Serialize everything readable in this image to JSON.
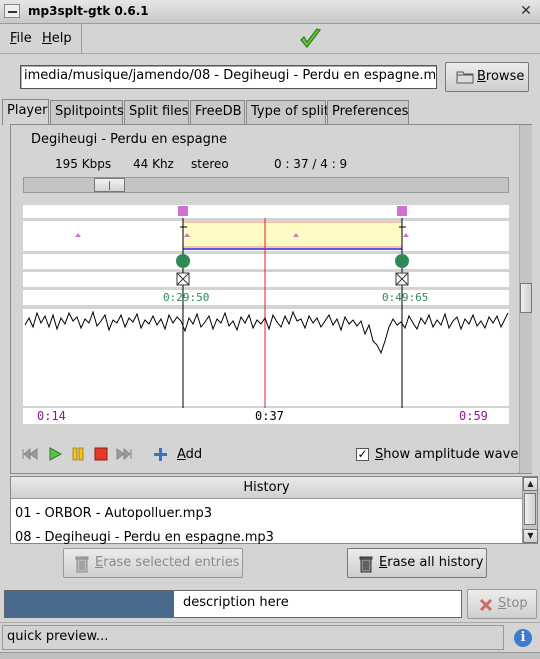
{
  "window": {
    "title": "mp3splt-gtk 0.6.1"
  },
  "menu": {
    "file": "File",
    "file_rest": "ile",
    "help": "Help",
    "help_rest": "elp",
    "file_u": "F",
    "help_u": "H"
  },
  "file_path": "imedia/musique/jamendo/08 - Degiheugi - Perdu en espagne.mp3",
  "browse": {
    "label": "Browse",
    "u": "B",
    "rest": "rowse"
  },
  "tabs": [
    "Player",
    "Splitpoints",
    "Split files",
    "FreeDB",
    "Type of split",
    "Preferences"
  ],
  "player": {
    "song_title": "Degiheugi - Perdu en espagne",
    "bitrate": "195 Kbps",
    "frequency": "44 Khz",
    "mode": "stereo",
    "time": "0 : 37 / 4 : 9",
    "position_fraction": 0.155,
    "splitpoints": [
      {
        "label": "0:29:50",
        "color": "#2e8b57"
      },
      {
        "label": "0:49:65",
        "color": "#2e8b57"
      }
    ],
    "timeline": {
      "left": "0:14",
      "center": "0:37",
      "right": "0:59"
    },
    "controls": {
      "add": "Add",
      "add_u": "A",
      "add_rest": "dd"
    },
    "show_amplitude": {
      "label": "Show amplitude wave",
      "u": "S",
      "rest": "how amplitude wave",
      "checked": true,
      "mark": "✓"
    },
    "colors": {
      "selection": "#fffbc4",
      "cursor": "#e02020",
      "splitpoint": "#2e8b57",
      "marker": "#d070d0",
      "time_accent": "#8b1a8b"
    }
  },
  "history": {
    "header": "History",
    "entries": [
      "01 - ORBOR - Autopolluer.mp3",
      "08 - Degiheugi - Perdu en espagne.mp3"
    ],
    "erase_selected": {
      "u": "E",
      "rest": "rase selected entries"
    },
    "erase_all": {
      "u": "E",
      "rest": "rase all history"
    }
  },
  "progress": {
    "fraction": 0.37,
    "text": "description here",
    "fill_color": "#4a6a8d"
  },
  "stop": {
    "u": "S",
    "rest": "top"
  },
  "status": {
    "text": "quick preview...",
    "info_glyph": "i"
  },
  "icons": [
    "ok-checkmark-icon",
    "folder-icon",
    "previous-icon",
    "play-icon",
    "pause-icon",
    "stop-icon",
    "next-icon",
    "add-icon",
    "trash-icon",
    "stop-x-icon",
    "info-icon"
  ]
}
